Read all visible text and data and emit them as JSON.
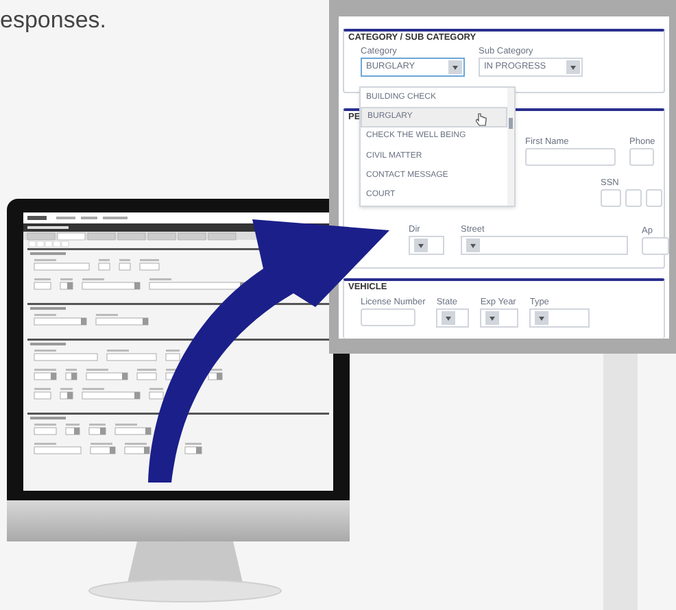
{
  "heading": "esponses.",
  "inset": {
    "category_section": {
      "title": "CATEGORY / SUB CATEGORY",
      "category_label": "Category",
      "category_value": "BURGLARY",
      "sub_category_label": "Sub Category",
      "sub_category_value": "IN PROGRESS"
    },
    "dropdown": [
      {
        "label": "BUILDING CHECK",
        "selected": false
      },
      {
        "label": "BURGLARY",
        "selected": true
      },
      {
        "label": "CHECK THE WELL BEING",
        "selected": false
      },
      {
        "label": "CIVIL MATTER",
        "selected": false
      },
      {
        "label": "CONTACT MESSAGE",
        "selected": false
      },
      {
        "label": "COURT",
        "selected": false
      }
    ],
    "person_section": {
      "title": "PE",
      "first_name_label": "First Name",
      "phone_label": "Phone",
      "ssn_label": "SSN",
      "dir_label": "Dir",
      "street_label": "Street",
      "apt_label": "Ap"
    },
    "vehicle_section": {
      "title": "VEHICLE",
      "labels": [
        "License Number",
        "State",
        "Exp Year",
        "Type"
      ]
    }
  }
}
